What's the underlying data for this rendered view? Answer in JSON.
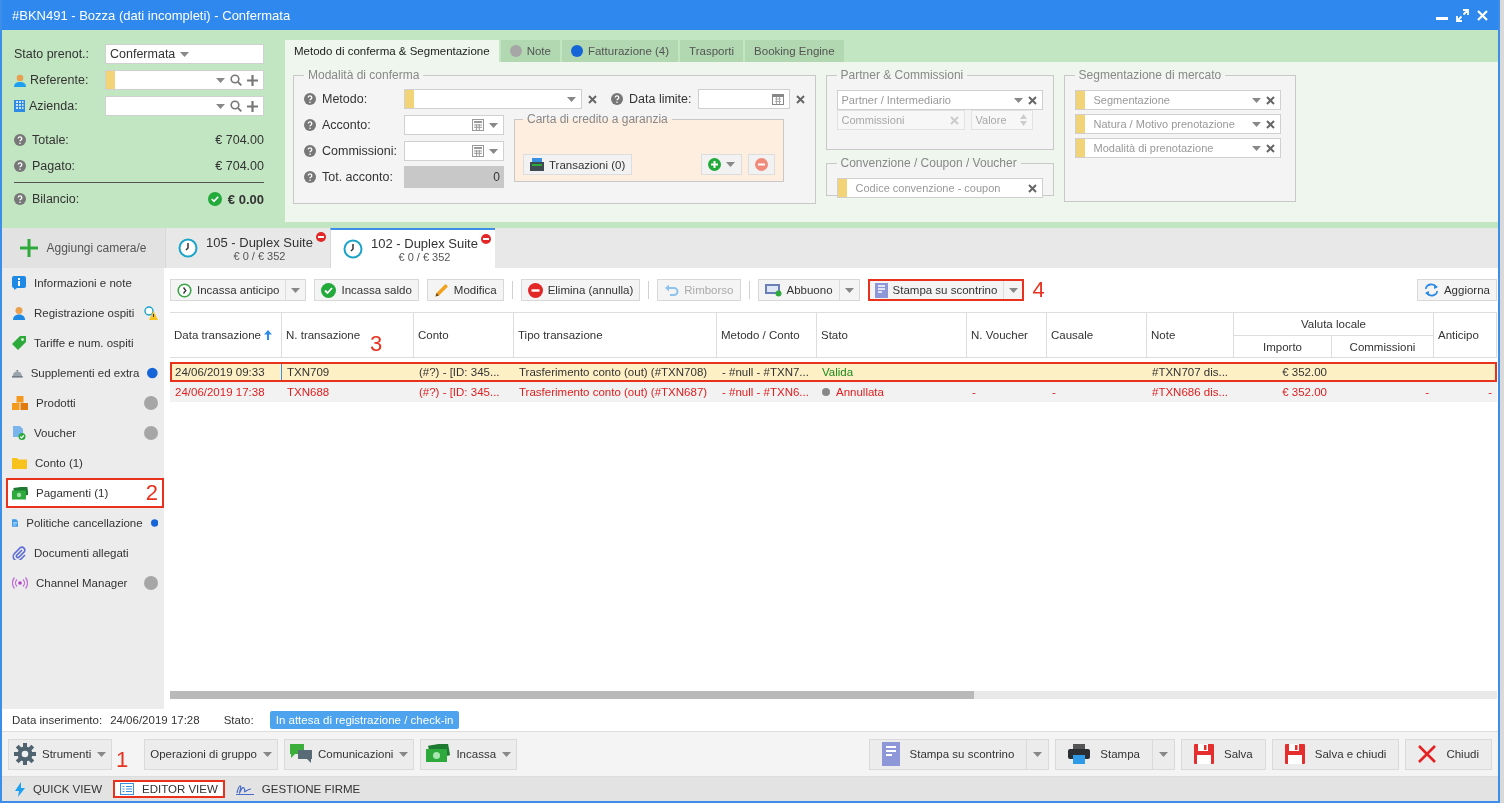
{
  "window": {
    "title": "#BKN491 - Bozza (dati incompleti) - Confermata"
  },
  "summary": {
    "stato_label": "Stato prenot.:",
    "stato_value": "Confermata",
    "referente_label": "Referente:",
    "azienda_label": "Azienda:",
    "totals": [
      {
        "label": "Totale:",
        "value": "€ 704.00"
      },
      {
        "label": "Pagato:",
        "value": "€ 704.00"
      }
    ],
    "balance": {
      "label": "Bilancio:",
      "value": "€ 0.00",
      "ok": true
    }
  },
  "top_tabs": [
    {
      "label": "Metodo di conferma & Segmentazione",
      "selected": true
    },
    {
      "label": "Note",
      "selected": false,
      "color": "#a6a6a6"
    },
    {
      "label": "Fatturazione (4)",
      "selected": false,
      "color": "#1565d8"
    },
    {
      "label": "Trasporti",
      "selected": false
    },
    {
      "label": "Booking Engine",
      "selected": false
    }
  ],
  "conferma": {
    "legend": "Modalità di conferma",
    "metodo_label": "Metodo:",
    "data_limite_label": "Data limite:",
    "acconto_label": "Acconto:",
    "commissioni_label": "Commissioni:",
    "tot_acconto_label": "Tot. acconto:",
    "tot_acconto_value": "0",
    "carta": {
      "legend": "Carta di credito a garanzia",
      "transazioni_button": "Transazioni (0)"
    }
  },
  "partner": {
    "legend": "Partner & Commissioni",
    "intermediario_placeholder": "Partner / Intermediario",
    "commissioni_placeholder": "Commissioni",
    "valore_placeholder": "Valore"
  },
  "convenzione": {
    "legend": "Convenzione / Coupon / Voucher",
    "codice_placeholder": "Codice convenzione - coupon"
  },
  "segmentazione": {
    "legend": "Segmentazione di mercato",
    "fields": [
      "Segmentazione",
      "Natura / Motivo prenotazione",
      "Modalità di prenotazione"
    ]
  },
  "add_room_button": "Aggiungi camera/e",
  "rooms": [
    {
      "name": "105 - Duplex Suite",
      "amount": "€ 0 / € 352",
      "selected": false
    },
    {
      "name": "102 - Duplex Suite",
      "amount": "€ 0 / € 352",
      "selected": true
    }
  ],
  "sidebar": {
    "items": [
      {
        "label": "Informazioni e note",
        "selected": false,
        "warning": false
      },
      {
        "label": "Registrazione ospiti",
        "selected": false,
        "warning": true
      },
      {
        "label": "Tariffe e num. ospiti",
        "selected": false,
        "warning": false
      },
      {
        "label": "Supplementi ed extra",
        "selected": false,
        "warning": false,
        "color": "#1565d8"
      },
      {
        "label": "Prodotti",
        "selected": false,
        "warning": false,
        "color": "#a6a6a6"
      },
      {
        "label": "Voucher",
        "selected": false,
        "warning": false,
        "color": "#a6a6a6"
      },
      {
        "label": "Conto (1)",
        "selected": false,
        "warning": false
      },
      {
        "label": "Pagamenti (1)",
        "selected": true,
        "warning": false,
        "callout": "2"
      },
      {
        "label": "Politiche cancellazione",
        "selected": false,
        "warning": false,
        "color": "#1565d8"
      },
      {
        "label": "Documenti allegati",
        "selected": false,
        "warning": false
      },
      {
        "label": "Channel Manager",
        "selected": false,
        "warning": false,
        "color": "#a6a6a6"
      }
    ]
  },
  "toolbar": {
    "buttons": [
      {
        "label": "Incassa anticipo",
        "split": true,
        "disabled": false
      },
      {
        "label": "Incassa saldo",
        "split": false,
        "disabled": false
      },
      {
        "label": "Modifica",
        "split": false,
        "disabled": false
      },
      {
        "label": "Elimina (annulla)",
        "split": false,
        "disabled": false
      },
      {
        "label": "Rimborso",
        "split": false,
        "disabled": true
      },
      {
        "label": "Abbuono",
        "split": true,
        "disabled": false
      },
      {
        "label": "Stampa su scontrino",
        "split": true,
        "disabled": false,
        "callout": "4"
      }
    ],
    "refresh_button": "Aggiorna"
  },
  "table": {
    "columns": [
      {
        "label": "Data transazione",
        "sorted": true
      },
      {
        "label": "N. transazione",
        "sorted": false
      },
      {
        "label": "Conto",
        "sorted": false
      },
      {
        "label": "Tipo transazione",
        "sorted": false
      },
      {
        "label": "Metodo / Conto",
        "sorted": false
      },
      {
        "label": "Stato",
        "sorted": false
      },
      {
        "label": "N. Voucher",
        "sorted": false
      },
      {
        "label": "Causale",
        "sorted": false
      },
      {
        "label": "Note",
        "sorted": false
      },
      {
        "label": "Anticipo",
        "sorted": false
      }
    ],
    "group": {
      "label": "Valuta locale",
      "columns": [
        "Importo",
        "Commissioni"
      ]
    },
    "rows": [
      {
        "selected": true,
        "cancelled": false,
        "callout": "3",
        "cells": [
          "24/06/2019 09:33",
          "TXN709",
          "(#?) - [ID: 345...",
          "Trasferimento conto (out) (#TXN708)",
          "- #null - #TXN7...",
          "Valida",
          null,
          null,
          "#TXN707 dis...",
          "€ 352.00",
          null,
          null
        ]
      },
      {
        "selected": false,
        "cancelled": true,
        "cells": [
          "24/06/2019 17:38",
          "TXN688",
          "(#?) - [ID: 345...",
          "Trasferimento conto (out) (#TXN687)",
          "- #null - #TXN6...",
          "Annullata",
          "-",
          "-",
          "#TXN686 dis...",
          "€ 352.00",
          "-",
          "-"
        ]
      }
    ]
  },
  "info": {
    "data_label": "Data inserimento:",
    "data_value": "24/06/2019 17:28",
    "stato_label": "Stato:",
    "stato_badge": "In attesa di registrazione / check-in"
  },
  "actions_left": [
    {
      "label": "Strumenti"
    },
    {
      "label": "Operazioni di gruppo"
    },
    {
      "label": "Comunicazioni"
    },
    {
      "label": "Incassa"
    }
  ],
  "actions_right": [
    {
      "label": "Stampa su scontrino",
      "split": true
    },
    {
      "label": "Stampa",
      "split": true
    },
    {
      "label": "Salva",
      "split": false
    },
    {
      "label": "Salva e chiudi",
      "split": false
    },
    {
      "label": "Chiudi",
      "split": false
    }
  ],
  "view_tabs": [
    {
      "label": "QUICK VIEW",
      "selected": false
    },
    {
      "label": "EDITOR VIEW",
      "selected": true,
      "callout": "1"
    },
    {
      "label": "GESTIONE FIRME",
      "selected": false
    }
  ]
}
